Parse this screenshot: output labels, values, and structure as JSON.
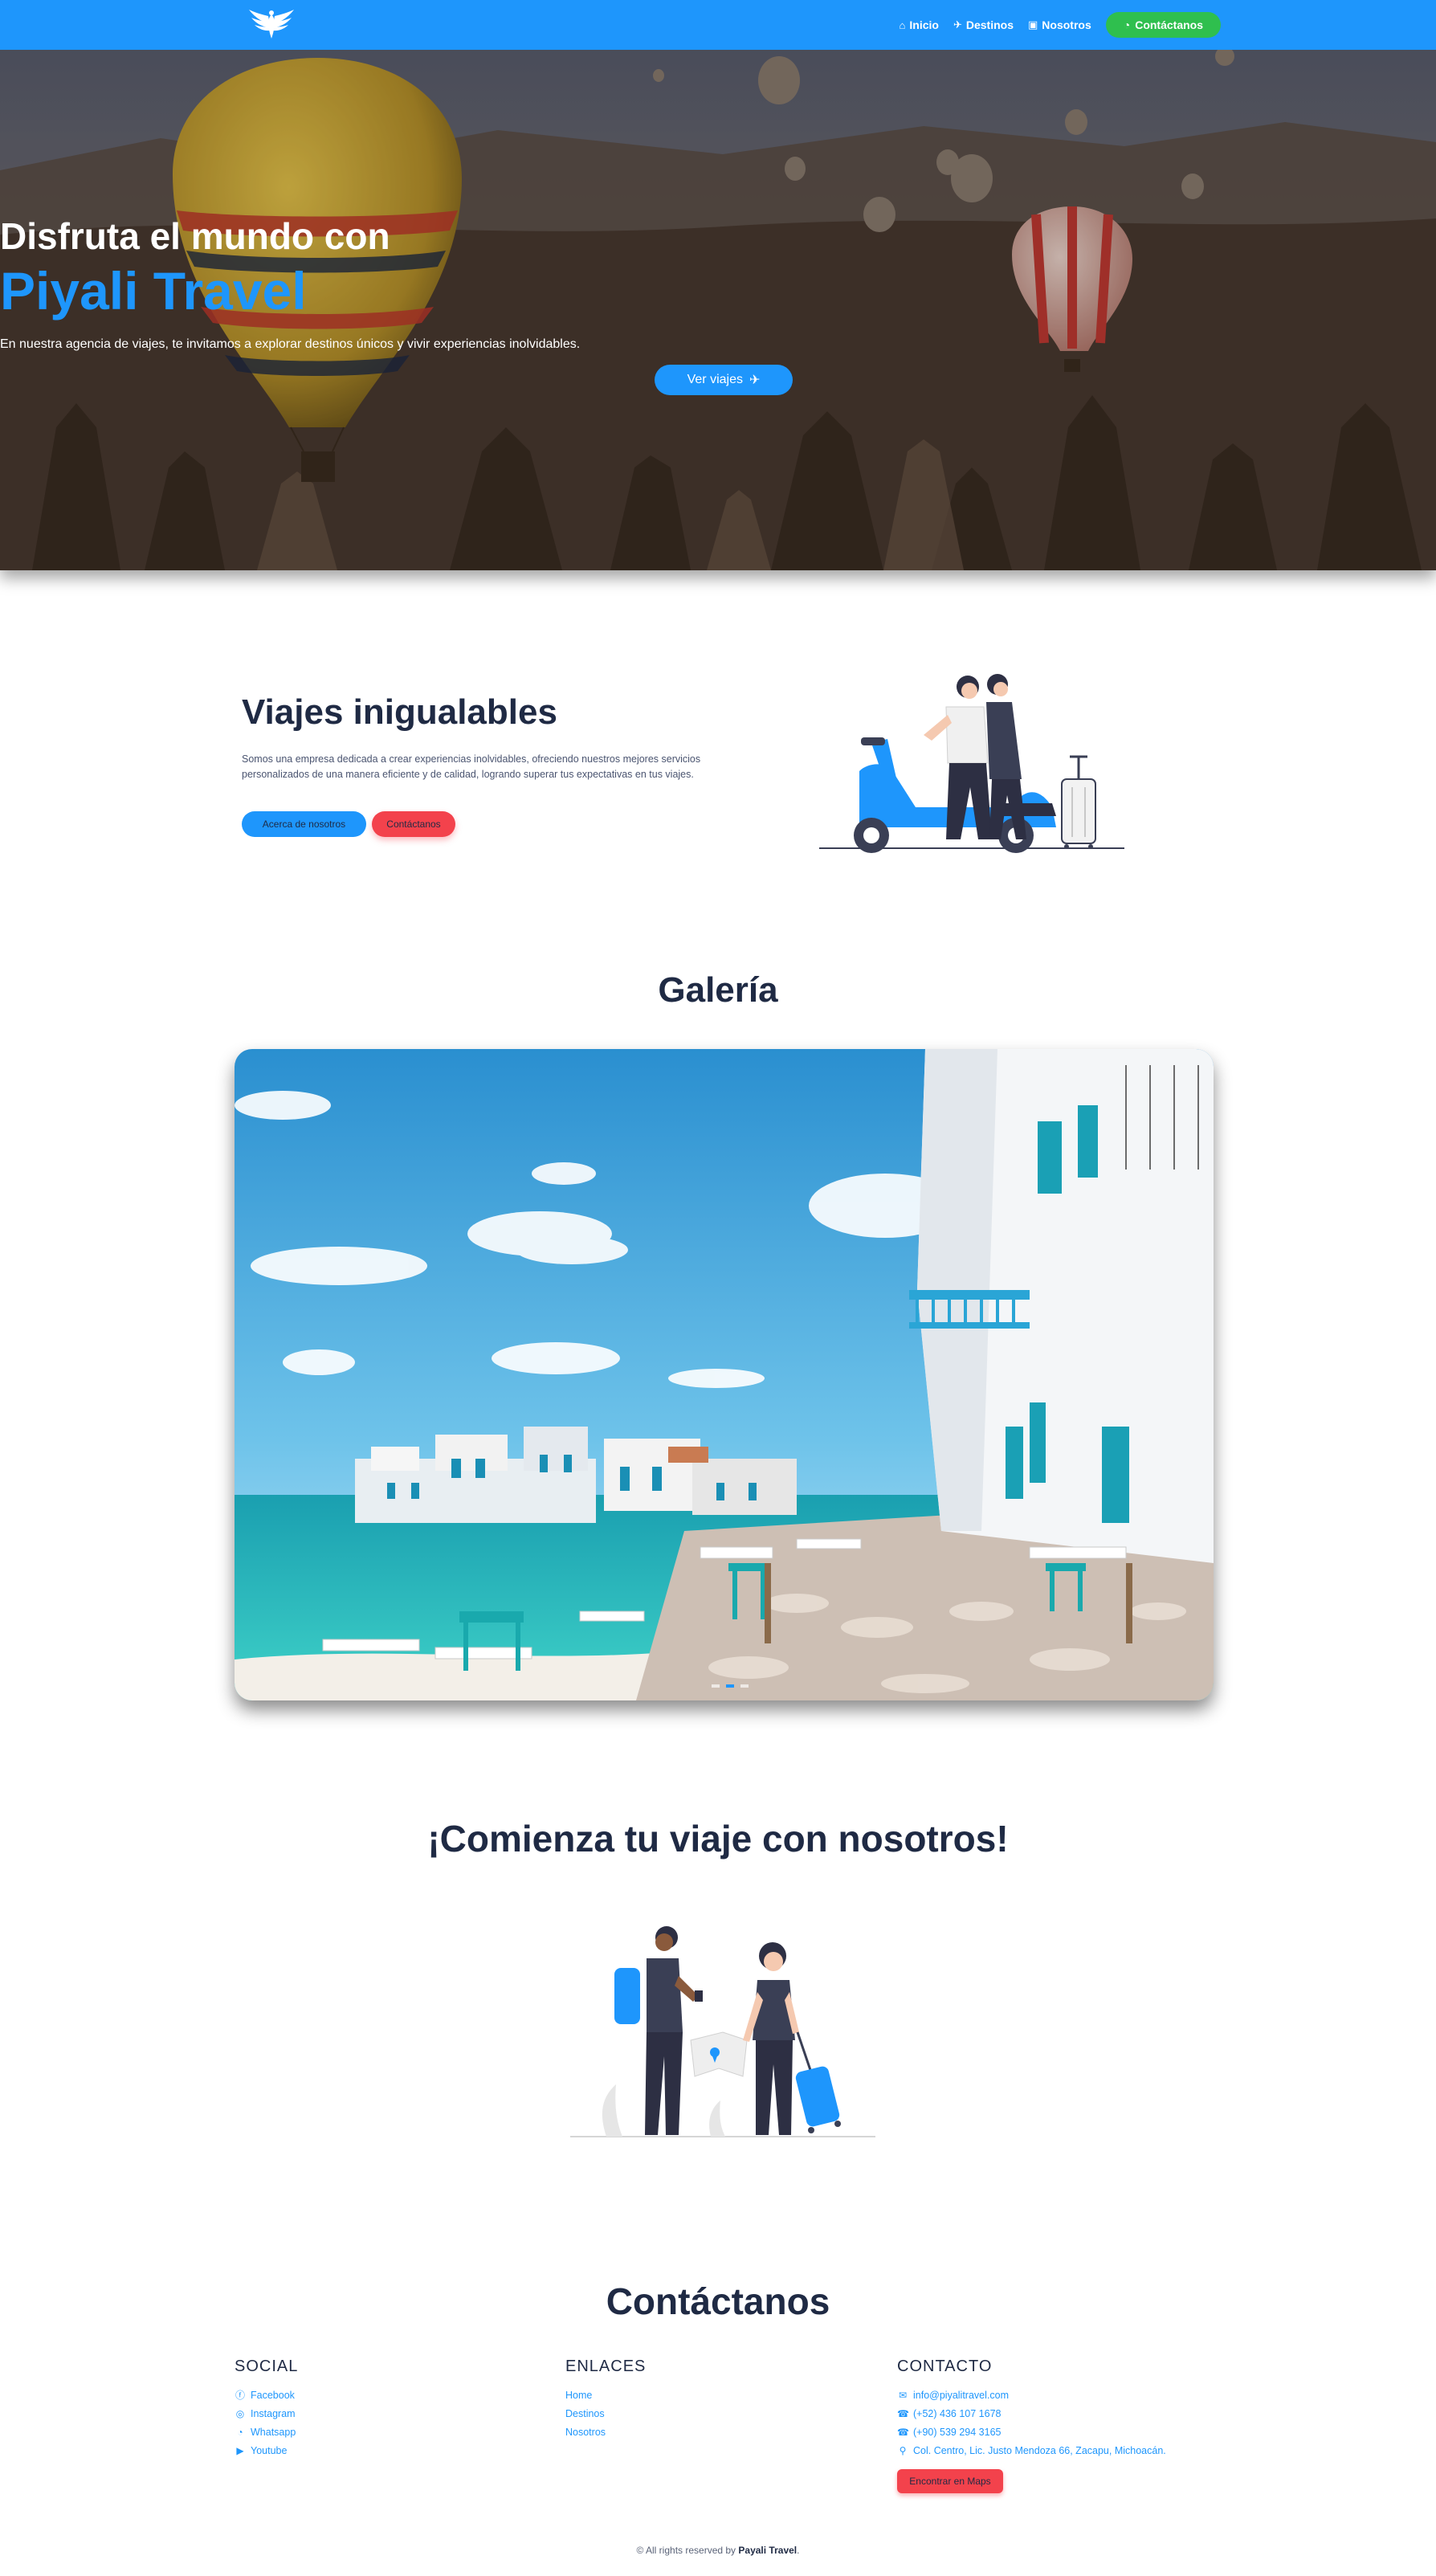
{
  "nav": {
    "logo_icon": "winged-logo-icon",
    "links": [
      {
        "label": "Inicio",
        "icon": "home-icon",
        "glyph": "⌂"
      },
      {
        "label": "Destinos",
        "icon": "plane-icon",
        "glyph": "✈"
      },
      {
        "label": "Nosotros",
        "icon": "id-card-icon",
        "glyph": "▣"
      }
    ],
    "contact": {
      "label": "Contáctanos",
      "icon": "whatsapp-icon",
      "glyph": "◔"
    }
  },
  "hero": {
    "line1": "Disfruta el mundo con",
    "line2": "Piyali Travel",
    "description": "En nuestra agencia de viajes, te invitamos a explorar destinos únicos y vivir experiencias inolvidables.",
    "button_label": "Ver viajes",
    "button_icon": "✈"
  },
  "about": {
    "title": "Viajes inigualables",
    "text": "Somos una empresa dedicada a crear experiencias inolvidables, ofreciendo nuestros mejores servicios personalizados de una manera eficiente y de calidad, logrando superar tus expectativas en tus viajes.",
    "button_about": "Acerca de nosotros",
    "button_contact": "Contáctanos"
  },
  "gallery": {
    "title": "Galería",
    "slide_count": 3,
    "active_slide": 2
  },
  "start": {
    "title": "¡Comienza tu viaje con nosotros!"
  },
  "contact": {
    "title": "Contáctanos",
    "social": {
      "heading": "SOCIAL",
      "items": [
        {
          "label": "Facebook",
          "icon": "facebook-icon",
          "glyph": "ⓕ"
        },
        {
          "label": "Instagram",
          "icon": "instagram-icon",
          "glyph": "◎"
        },
        {
          "label": "Whatsapp",
          "icon": "whatsapp-icon",
          "glyph": "◔"
        },
        {
          "label": "Youtube",
          "icon": "youtube-icon",
          "glyph": "▶"
        }
      ]
    },
    "links": {
      "heading": "ENLACES",
      "items": [
        "Home",
        "Destinos",
        "Nosotros"
      ]
    },
    "info": {
      "heading": "CONTACTO",
      "items": [
        {
          "label": "info@piyalitravel.com",
          "icon": "mail-icon",
          "glyph": "✉"
        },
        {
          "label": "(+52) 436 107 1678",
          "icon": "phone-icon",
          "glyph": "☎"
        },
        {
          "label": "(+90) 539 294 3165",
          "icon": "phone-icon",
          "glyph": "☎"
        },
        {
          "label": "Col. Centro, Lic. Justo Mendoza 66, Zacapu, Michoacán.",
          "icon": "map-pin-icon",
          "glyph": "⚲"
        }
      ],
      "maps_button": "Encontrar en Maps"
    }
  },
  "footer": {
    "prefix": "© All rights reserved by",
    "brand": "Payali Travel",
    "suffix": "."
  },
  "colors": {
    "primary": "#1e96fc",
    "whatsapp": "#2fbf4e",
    "accent_red": "#f3424c",
    "heading": "#1f2a44"
  }
}
